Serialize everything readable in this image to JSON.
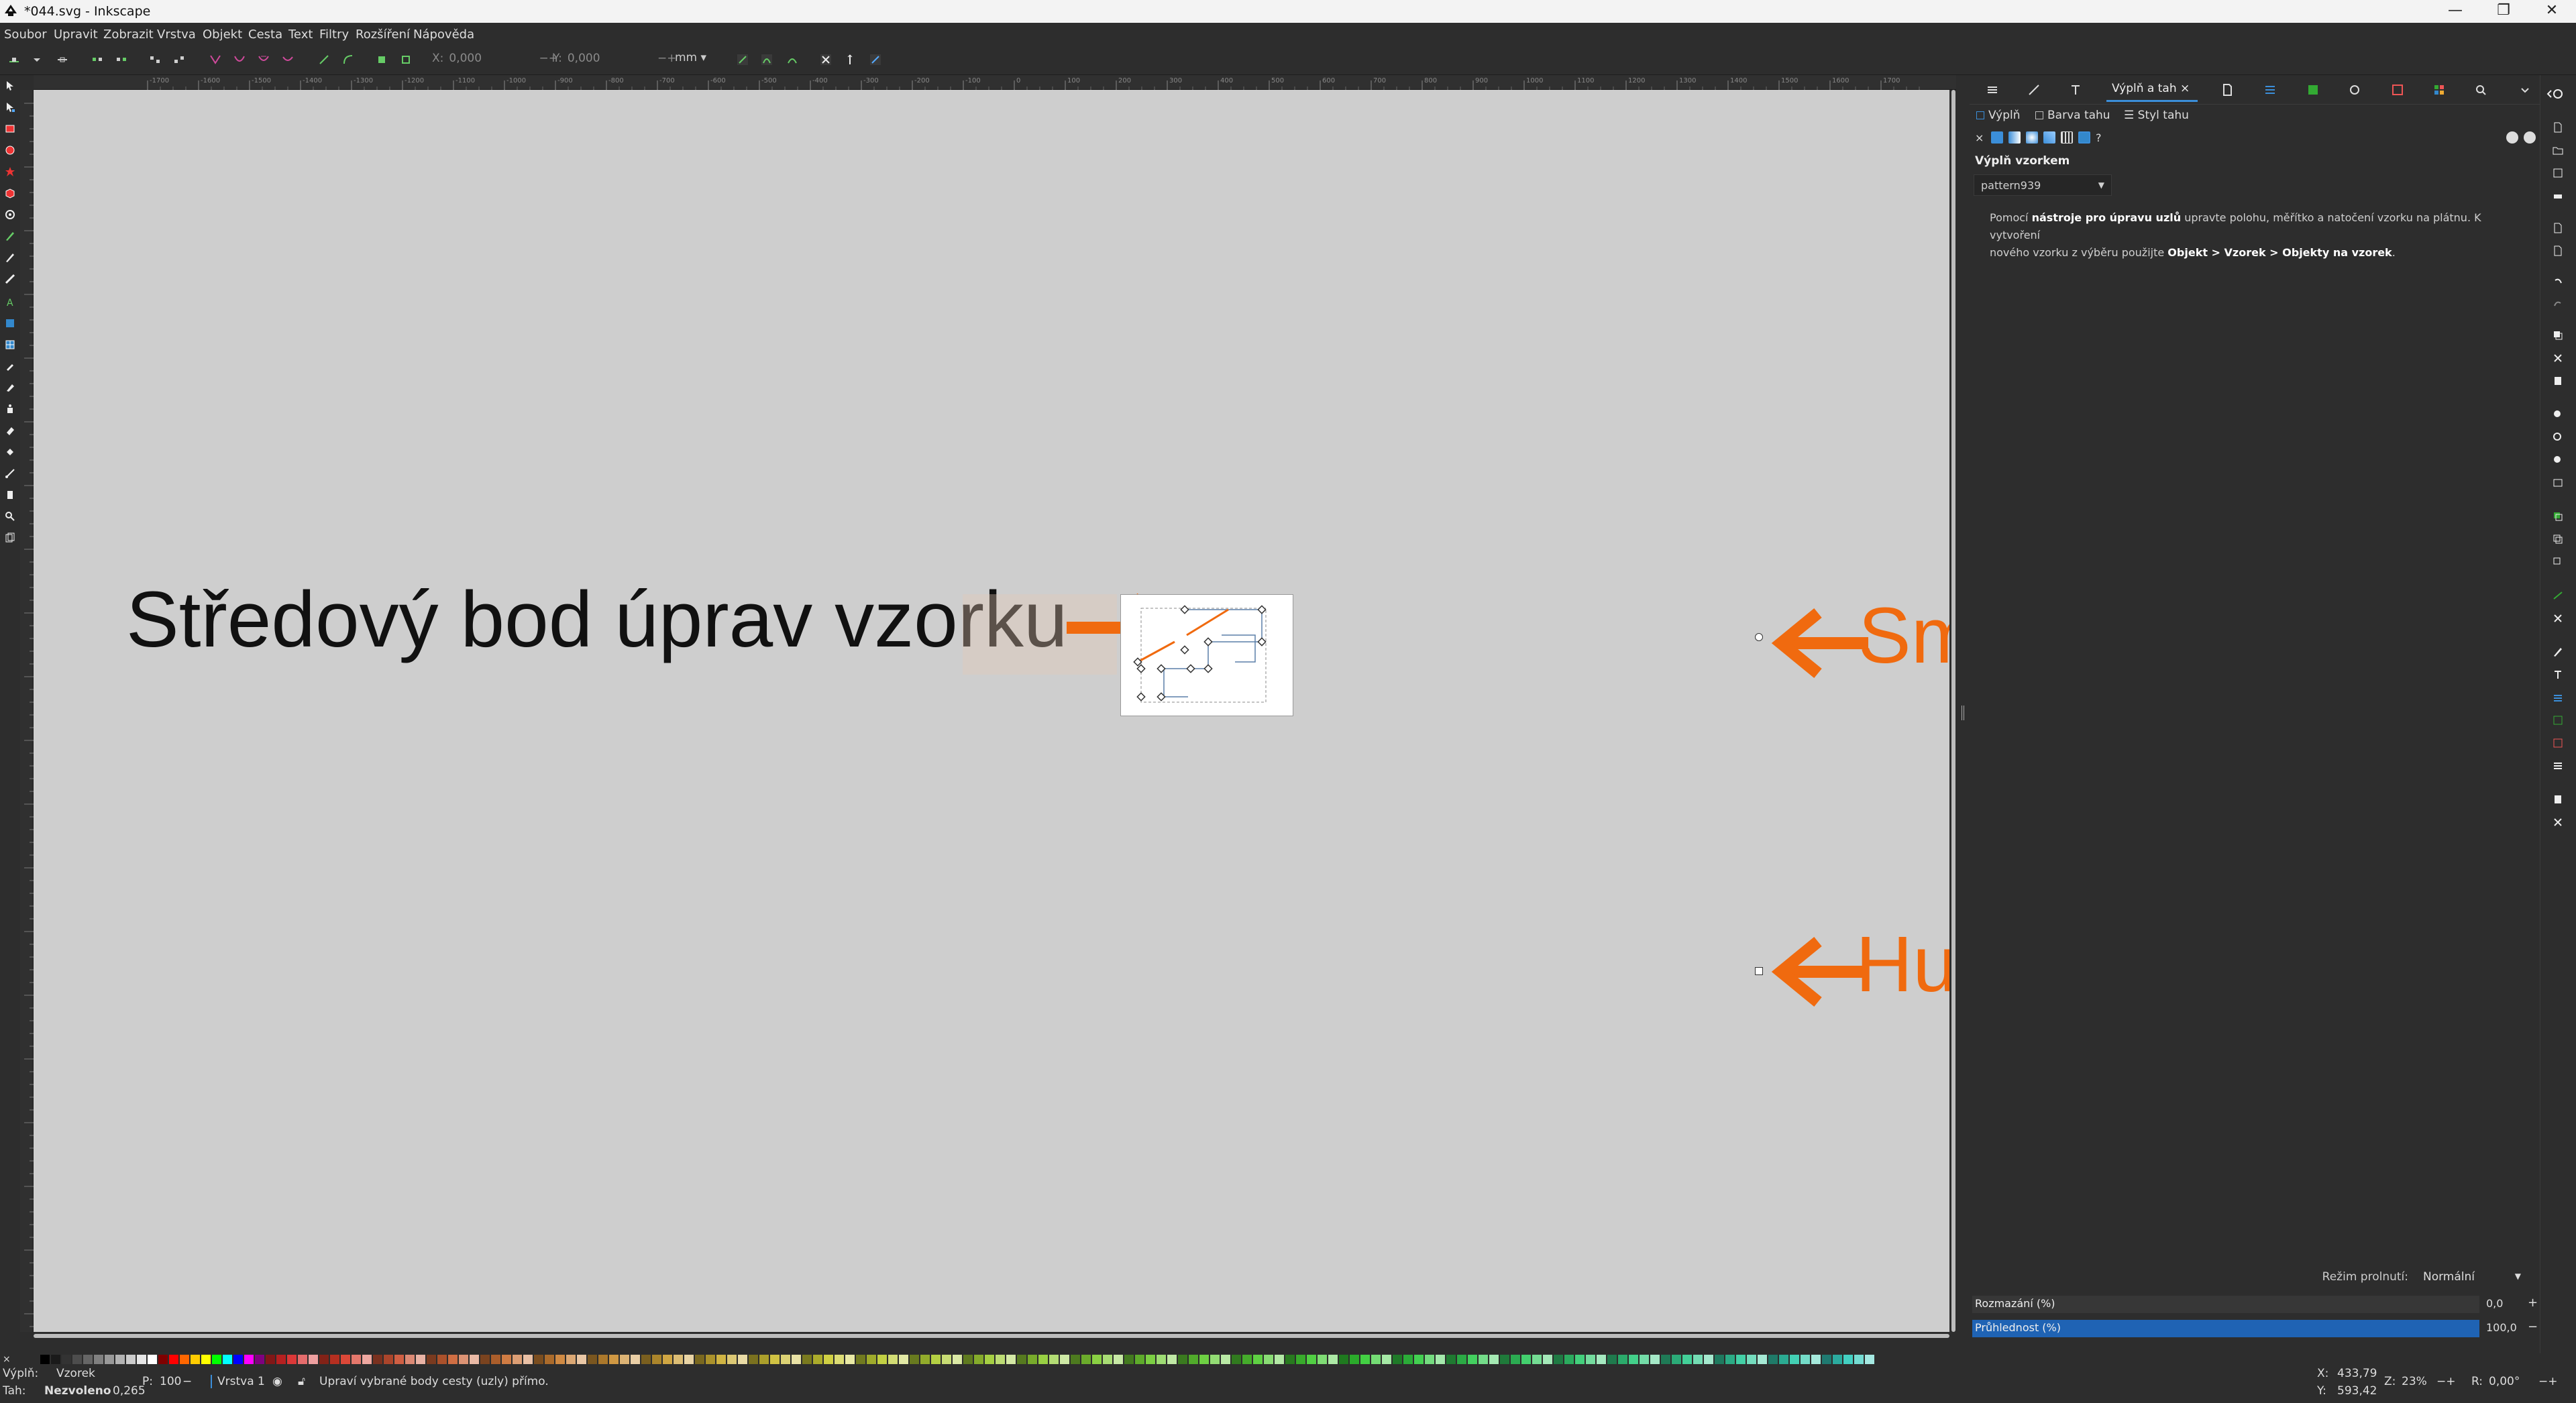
{
  "window": {
    "title": "*044.svg - Inkscape",
    "controls": [
      "—",
      "❐",
      "✕"
    ]
  },
  "menu": [
    "Soubor",
    "Upravit",
    "Zobrazit",
    "Vrstva",
    "Objekt",
    "Cesta",
    "Text",
    "Filtry",
    "Rozšíření",
    "Nápověda"
  ],
  "toolbar": {
    "x_label": "X:",
    "x_value": "0,000",
    "y_label": "Y:",
    "y_value": "0,000",
    "unit": "mm"
  },
  "ruler_ticks": [
    "-1700",
    "-1600",
    "-1500",
    "-1400",
    "-1300",
    "-1200",
    "-1100",
    "-1000",
    "-900",
    "-800",
    "-700",
    "-600",
    "-500",
    "-400",
    "-300",
    "-200",
    "-100",
    "0",
    "100",
    "200",
    "300",
    "400",
    "500",
    "600",
    "700",
    "800",
    "900",
    "1000",
    "1100",
    "1200",
    "1300",
    "1400",
    "1500",
    "1600",
    "1700"
  ],
  "canvas": {
    "center_label": "Středový bod úprav vzorku",
    "direction_label": "Směr",
    "density_label": "Hustota"
  },
  "dialog": {
    "active_tab": "Výplň a tah",
    "subtabs": [
      "Výplň",
      "Barva tahu",
      "Styl tahu"
    ],
    "section_title": "Výplň vzorkem",
    "pattern_name": "pattern939",
    "help_line1_pre": "Pomocí ",
    "help_line1_bold": "nástroje pro úpravu uzlů",
    "help_line1_post": " upravte polohu, měřítko a natočení vzorku na plátnu. K vytvoření",
    "help_line2_pre": "nového vzorku z výběru použijte ",
    "help_line2_bold": "Objekt > Vzorek > Objekty na vzorek",
    "help_line2_post": ".",
    "blend_label": "Režim prolnutí:",
    "blend_value": "Normální",
    "blur_label": "Rozmazání (%)",
    "blur_value": "0,0",
    "opacity_label": "Průhlednost (%)",
    "opacity_value": "100,0",
    "opacity_fraction": 1.0
  },
  "colors": {
    "accent_orange": "#f06a0f",
    "selection_blue": "#1f63b4",
    "canvas_gray": "#cecece"
  },
  "status": {
    "fill_label": "Výplň:",
    "fill_value": "Vzorek",
    "stroke_label": "Tah:",
    "stroke_value": "Nezvoleno",
    "stroke_width": "0,265",
    "opacity_label": "P:",
    "opacity_value": "100",
    "layer": "Vrstva 1",
    "message": "Upraví vybrané body cesty (uzly) přímo.",
    "x_label": "X:",
    "x_value": "433,79",
    "y_label": "Y:",
    "y_value": "593,42",
    "zoom_label": "Z:",
    "zoom_value": "23%",
    "rotation_label": "R:",
    "rotation_value": "0,00°"
  }
}
